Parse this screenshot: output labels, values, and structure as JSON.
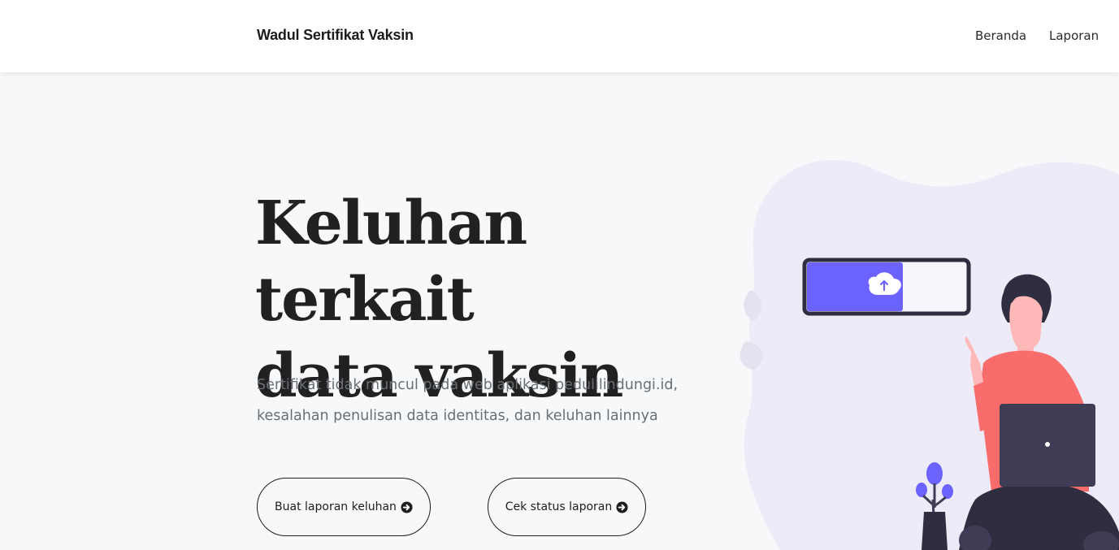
{
  "navbar": {
    "brand": "Wadul Sertifikat Vaksin",
    "links": [
      {
        "label": "Beranda"
      },
      {
        "label": "Laporan"
      }
    ]
  },
  "hero": {
    "title_lines": [
      "Keluhan terkait",
      "data vaksin"
    ],
    "subtitle_lines": [
      "Sertifikat tidak muncul pada web aplikasi pedulilindungi.id,",
      "kesalahan penulisan data identitas, dan keluhan lainnya"
    ],
    "buttons": {
      "create_report": "Buat laporan keluhan",
      "check_status": "Cek status laporan"
    }
  },
  "illustration": {
    "icons": [
      "upload-cloud-icon",
      "leaf-icon",
      "laptop-icon",
      "plant-icon"
    ],
    "colors": {
      "blob": "#ecebf7",
      "accent": "#6c63ff",
      "shirt": "#f86c6b",
      "skin": "#ffb8b8",
      "hair": "#2f2e41",
      "laptop": "#3f3d56"
    },
    "upload_progress": 0.6
  },
  "theme": {
    "background": "#f7f8fa",
    "text": "#212121",
    "muted": "#6a6f76"
  }
}
